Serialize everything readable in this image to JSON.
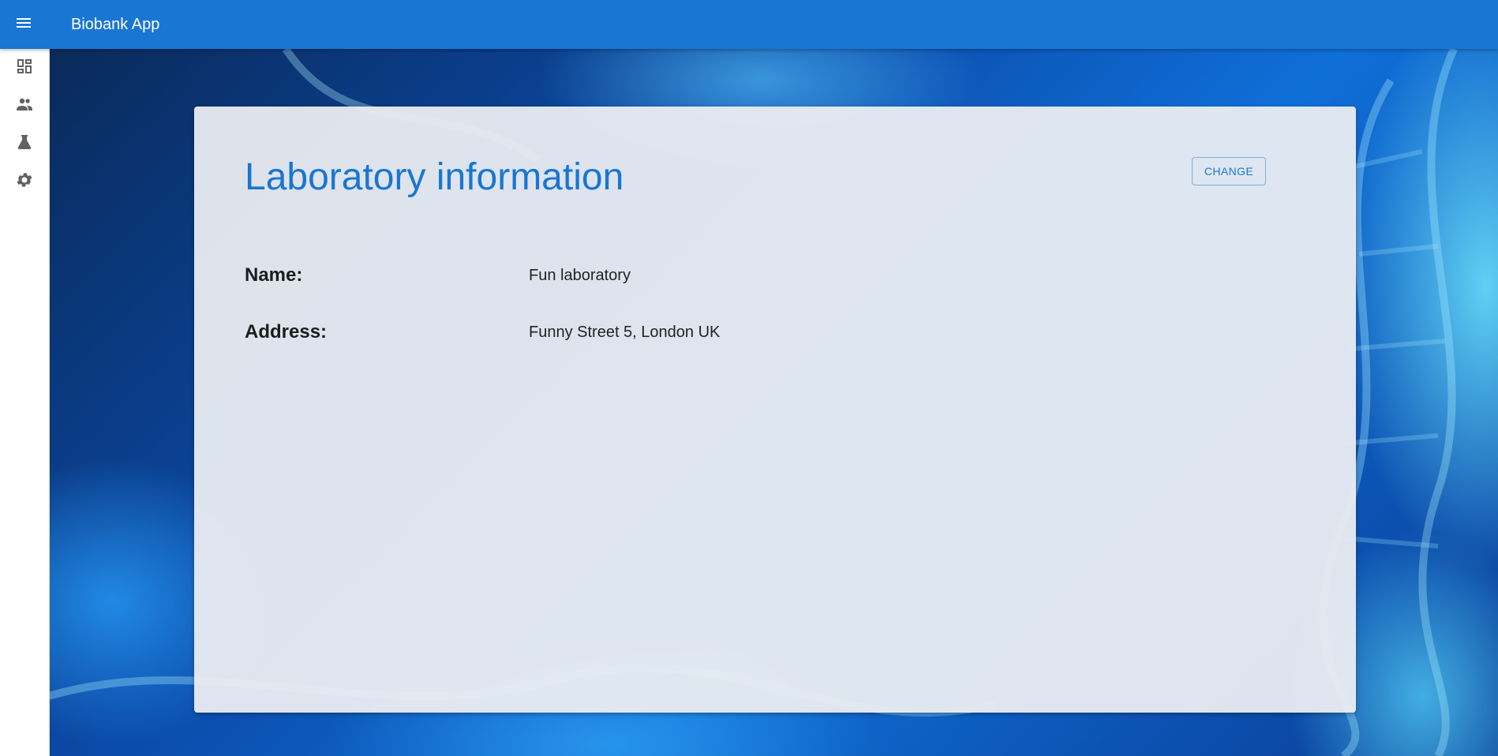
{
  "app": {
    "title": "Biobank App",
    "primary_color": "#1976d2"
  },
  "appbar": {
    "menu_icon": "menu-icon"
  },
  "drawer": {
    "items": [
      {
        "icon": "dashboard-icon"
      },
      {
        "icon": "people-icon"
      },
      {
        "icon": "flask-icon"
      },
      {
        "icon": "gear-icon"
      }
    ]
  },
  "card": {
    "title": "Laboratory information",
    "change_label": "CHANGE",
    "fields": [
      {
        "label": "Name:",
        "value": "Fun laboratory"
      },
      {
        "label": "Address:",
        "value": "Funny Street 5, London UK"
      }
    ]
  }
}
